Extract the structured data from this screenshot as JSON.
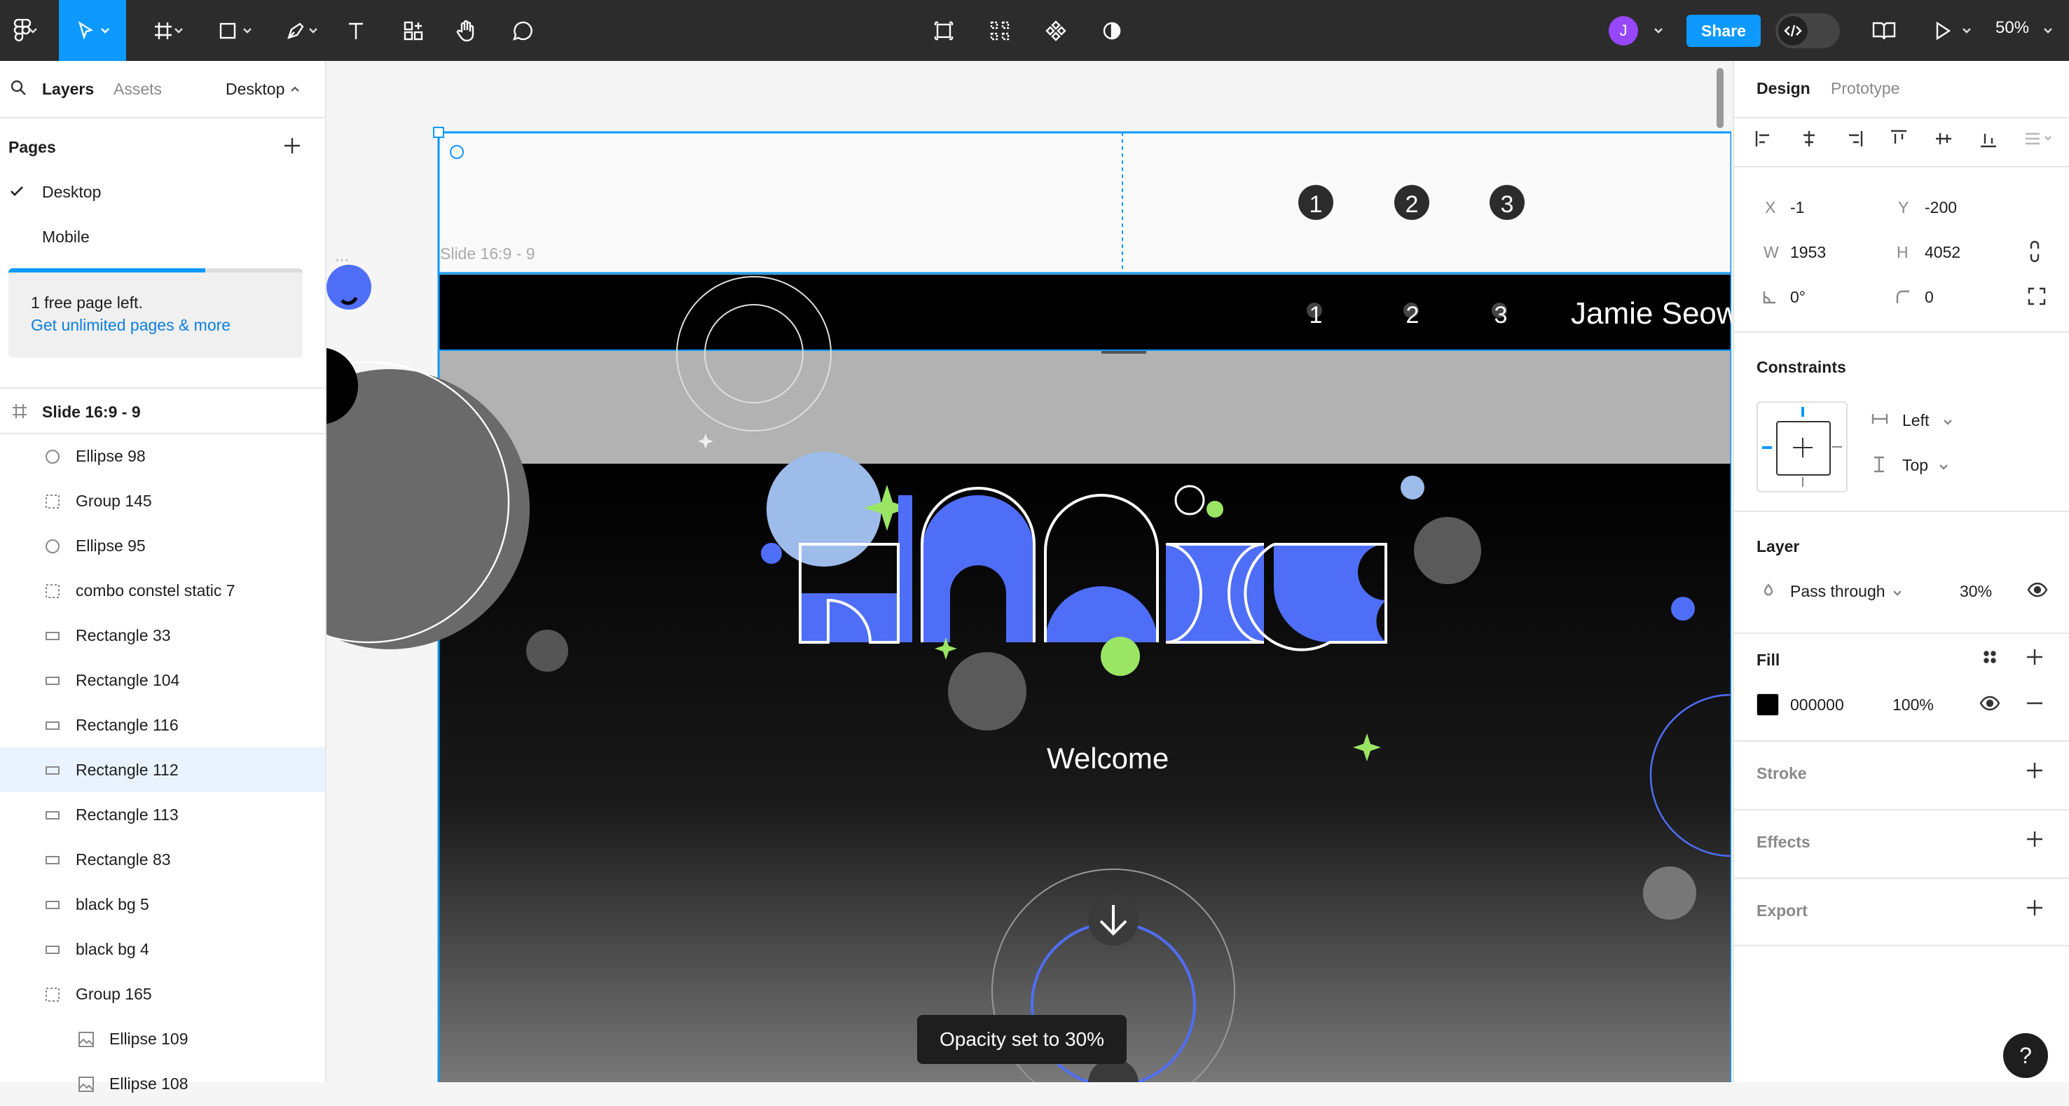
{
  "toolbar": {
    "share_label": "Share",
    "zoom_label": "50%",
    "user_initial": "J"
  },
  "left_panel": {
    "tabs": {
      "layers": "Layers",
      "assets": "Assets"
    },
    "page_switch": "Desktop",
    "pages_title": "Pages",
    "pages": [
      {
        "label": "Desktop",
        "active": true
      },
      {
        "label": "Mobile",
        "active": false
      }
    ],
    "notice": {
      "text": "1 free page left.",
      "link": "Get unlimited pages & more",
      "progress": 0.67
    },
    "frame_label": "Slide 16:9 - 9",
    "layers": [
      {
        "label": "Ellipse 98",
        "icon": "ellipse-icon"
      },
      {
        "label": "Group 145",
        "icon": "group-icon"
      },
      {
        "label": "Ellipse 95",
        "icon": "ellipse-icon"
      },
      {
        "label": "combo constel static 7",
        "icon": "group-icon"
      },
      {
        "label": "Rectangle 33",
        "icon": "rectangle-icon"
      },
      {
        "label": "Rectangle 104",
        "icon": "rectangle-icon"
      },
      {
        "label": "Rectangle 116",
        "icon": "rectangle-icon"
      },
      {
        "label": "Rectangle 112",
        "icon": "rectangle-icon",
        "selected": true
      },
      {
        "label": "Rectangle 113",
        "icon": "rectangle-icon"
      },
      {
        "label": "Rectangle 83",
        "icon": "rectangle-icon"
      },
      {
        "label": "black bg 5",
        "icon": "rectangle-icon"
      },
      {
        "label": "black bg 4",
        "icon": "rectangle-icon"
      },
      {
        "label": "Group 165",
        "icon": "group-icon"
      },
      {
        "label": "Ellipse 109",
        "icon": "image-icon",
        "indent": true
      },
      {
        "label": "Ellipse 108",
        "icon": "image-icon",
        "indent": true
      }
    ]
  },
  "canvas": {
    "frame_name": "Slide 16:9 - 9",
    "nav_numbers": [
      "1",
      "2",
      "3"
    ],
    "header_name": "Jamie Seow",
    "welcome": "Welcome",
    "toast": "Opacity set to 30%"
  },
  "right_panel": {
    "tabs": {
      "design": "Design",
      "prototype": "Prototype"
    },
    "x_label": "X",
    "x_value": "-1",
    "y_label": "Y",
    "y_value": "-200",
    "w_label": "W",
    "w_value": "1953",
    "h_label": "H",
    "h_value": "4052",
    "rotation_value": "0°",
    "radius_value": "0",
    "constraints_title": "Constraints",
    "constraint_h": "Left",
    "constraint_v": "Top",
    "layer_title": "Layer",
    "blend_mode": "Pass through",
    "opacity": "30%",
    "fill_title": "Fill",
    "fill_hex": "000000",
    "fill_opacity": "100%",
    "stroke_title": "Stroke",
    "effects_title": "Effects",
    "export_title": "Export",
    "help": "?"
  },
  "colors": {
    "accent": "#0d99ff",
    "brand_blue": "#4f6ef7",
    "brand_green": "#9be564",
    "light_blue": "#9dbcea",
    "toolbar_bg": "#2c2c2c"
  }
}
